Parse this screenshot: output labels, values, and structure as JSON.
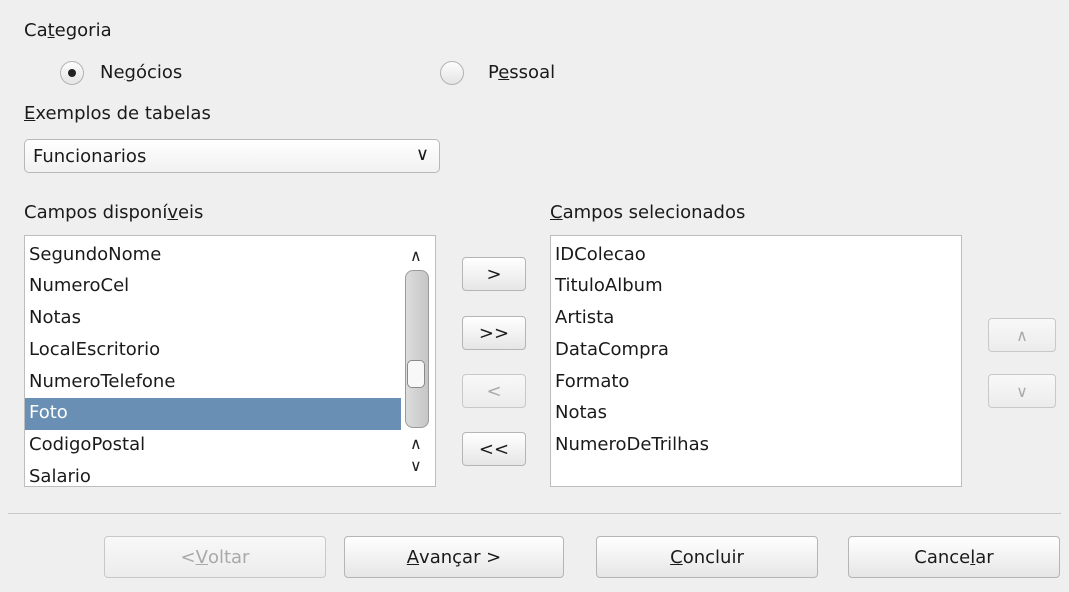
{
  "categoria": {
    "label_pre": "Ca",
    "label_accel": "t",
    "label_post": "egoria",
    "options": [
      {
        "pre": "Ne",
        "accel": "g",
        "post": "ócios",
        "selected": true
      },
      {
        "pre": "P",
        "accel": "e",
        "post": "ssoal",
        "selected": false
      }
    ]
  },
  "exemplos": {
    "label_accel": "E",
    "label_post": "xemplos de tabelas",
    "selected_value": "Funcionarios",
    "dropdown_icon": "chevron-down-icon"
  },
  "available": {
    "label_pre": "Campos disponí",
    "label_accel": "v",
    "label_post": "eis",
    "items": [
      "SegundoNome",
      "NumeroCel",
      "Notas",
      "LocalEscritorio",
      "NumeroTelefone",
      "Foto",
      "CodigoPostal",
      "Salario"
    ],
    "selected_item": "Foto"
  },
  "transfer": {
    "move_one": ">",
    "move_all": ">>",
    "remove_one": "<",
    "remove_all": "<<"
  },
  "selected_fields": {
    "label_accel": "C",
    "label_post": "ampos selecionados",
    "items": [
      "IDColecao",
      "TituloAlbum",
      "Artista",
      "DataCompra",
      "Formato",
      "Notas",
      "NumeroDeTrilhas"
    ]
  },
  "order": {
    "up": "∧",
    "down": "∨"
  },
  "footer": {
    "back_pre": "< ",
    "back_accel": "V",
    "back_post": "oltar",
    "next_accel": "A",
    "next_post": "vançar >",
    "finish_accel": "C",
    "finish_post": "oncluir",
    "cancel_pre": "Cance",
    "cancel_accel": "l",
    "cancel_post": "ar"
  }
}
